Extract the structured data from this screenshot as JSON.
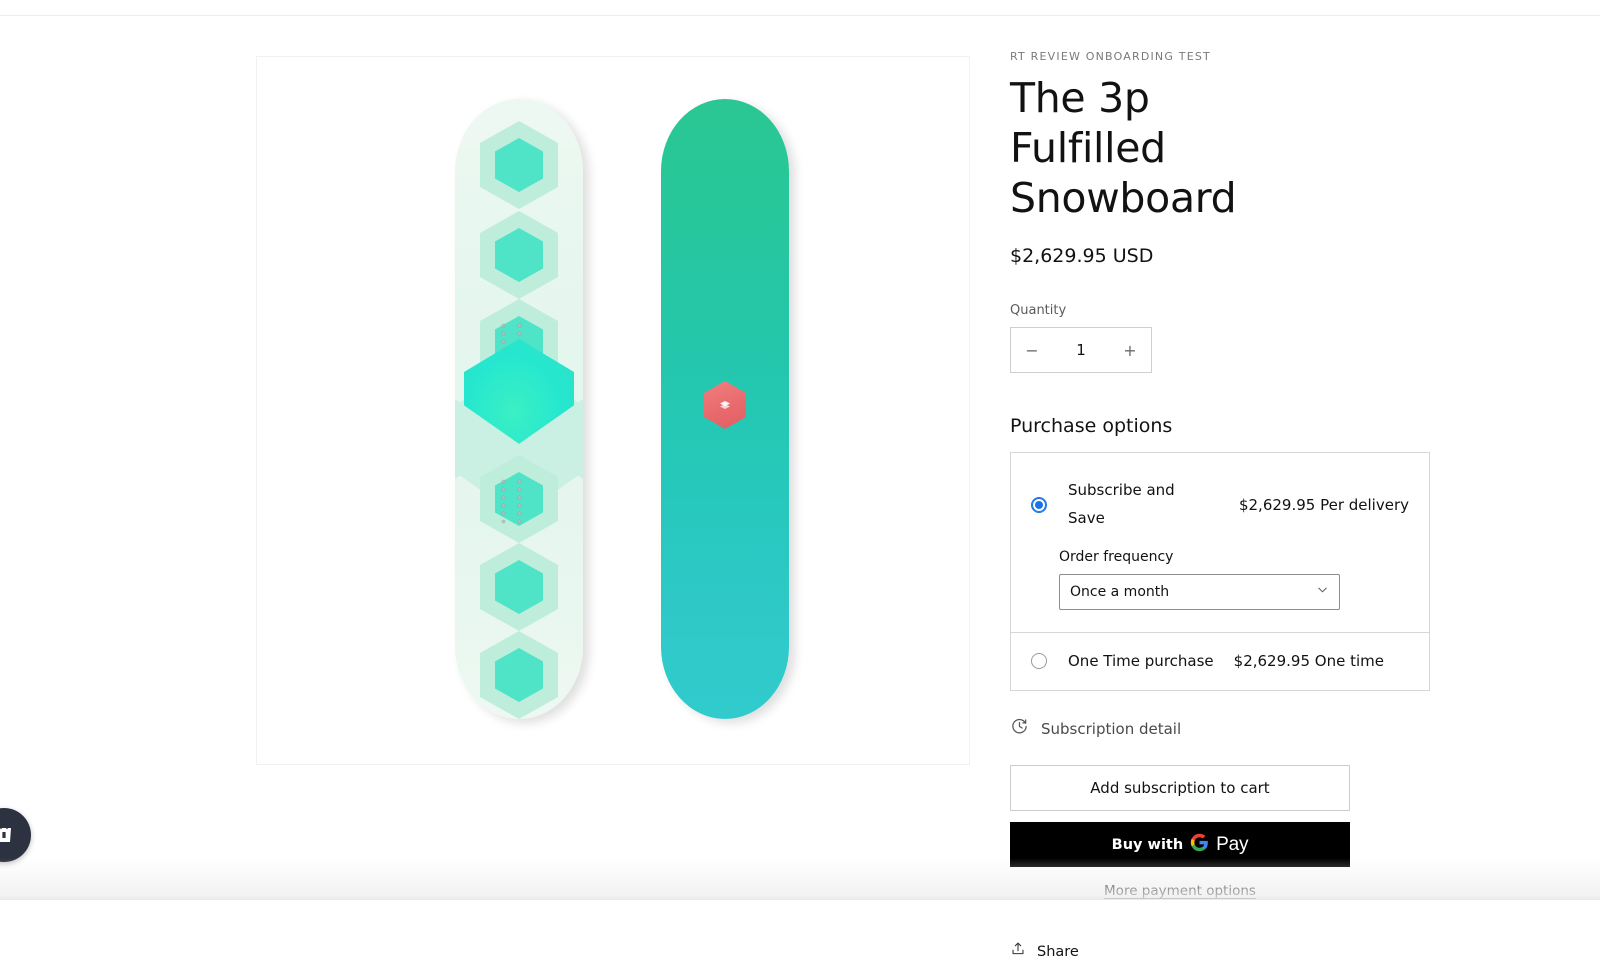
{
  "product": {
    "vendor": "RT REVIEW ONBOARDING TEST",
    "title": "The 3p Fulfilled Snowboard",
    "price": "$2,629.95 USD"
  },
  "quantity": {
    "label": "Quantity",
    "decrease_label": "−",
    "value": "1",
    "increase_label": "+"
  },
  "purchase_options": {
    "heading": "Purchase options",
    "subscribe": {
      "name": "Subscribe and Save",
      "price": "$2,629.95 Per delivery",
      "selected": true,
      "frequency_label": "Order frequency",
      "frequency_value": "Once a month"
    },
    "one_time": {
      "name": "One Time purchase",
      "price": "$2,629.95 One time",
      "selected": false
    }
  },
  "subscription_detail": {
    "label": "Subscription detail",
    "icon": "clock-refresh-icon"
  },
  "actions": {
    "add_to_cart": "Add subscription to cart",
    "gpay_prefix": "Buy with",
    "gpay_suffix": "Pay",
    "more_payment_options": "More payment options",
    "share": "Share"
  },
  "gallery": {
    "boards": [
      {
        "name": "snowboard-topsheet",
        "alt": "The 3p Fulfilled Snowboard topsheet"
      },
      {
        "name": "snowboard-base",
        "alt": "The 3p Fulfilled Snowboard base"
      }
    ]
  },
  "cart_bubble": {
    "icon": "shopping-bag-icon"
  },
  "colors": {
    "accent_radio": "#1a73e8",
    "board_green": "#2ac793",
    "board_cyan": "#31cbcd",
    "logo_pink": "#e8686b",
    "hex_light": "#bfeddc",
    "hex_bright": "#4fe3c8",
    "bubble_dark": "#2c3240",
    "gpay_bg": "#000000"
  }
}
